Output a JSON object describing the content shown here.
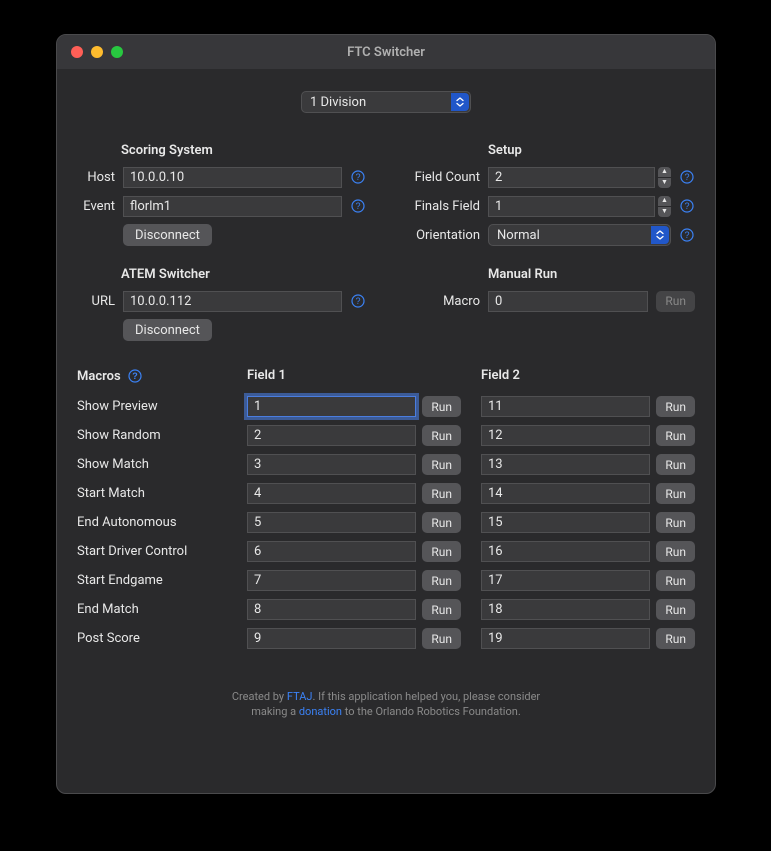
{
  "window": {
    "title": "FTC Switcher"
  },
  "division": {
    "selected": "1 Division"
  },
  "scoring_system": {
    "heading": "Scoring System",
    "host_label": "Host",
    "host_value": "10.0.0.10",
    "event_label": "Event",
    "event_value": "florlm1",
    "disconnect_label": "Disconnect"
  },
  "atem": {
    "heading": "ATEM Switcher",
    "url_label": "URL",
    "url_value": "10.0.0.112",
    "disconnect_label": "Disconnect"
  },
  "setup": {
    "heading": "Setup",
    "field_count_label": "Field Count",
    "field_count_value": "2",
    "finals_field_label": "Finals Field",
    "finals_field_value": "1",
    "orientation_label": "Orientation",
    "orientation_value": "Normal"
  },
  "manual_run": {
    "heading": "Manual Run",
    "macro_label": "Macro",
    "macro_value": "0",
    "run_label": "Run"
  },
  "macros": {
    "heading": "Macros",
    "field1_heading": "Field 1",
    "field2_heading": "Field 2",
    "run_label": "Run",
    "rows": [
      {
        "label": "Show Preview",
        "f1": "1",
        "f2": "11",
        "focused": true
      },
      {
        "label": "Show Random",
        "f1": "2",
        "f2": "12"
      },
      {
        "label": "Show Match",
        "f1": "3",
        "f2": "13"
      },
      {
        "label": "Start Match",
        "f1": "4",
        "f2": "14"
      },
      {
        "label": "End Autonomous",
        "f1": "5",
        "f2": "15"
      },
      {
        "label": "Start Driver Control",
        "f1": "6",
        "f2": "16"
      },
      {
        "label": "Start Endgame",
        "f1": "7",
        "f2": "17"
      },
      {
        "label": "End Match",
        "f1": "8",
        "f2": "18"
      },
      {
        "label": "Post Score",
        "f1": "9",
        "f2": "19"
      }
    ]
  },
  "footer": {
    "line1_a": "Created by ",
    "link1": "FTAJ",
    "line1_b": ". If this application helped you, please consider",
    "line2_a": "making a ",
    "link2": "donation",
    "line2_b": " to the Orlando Robotics Foundation."
  }
}
